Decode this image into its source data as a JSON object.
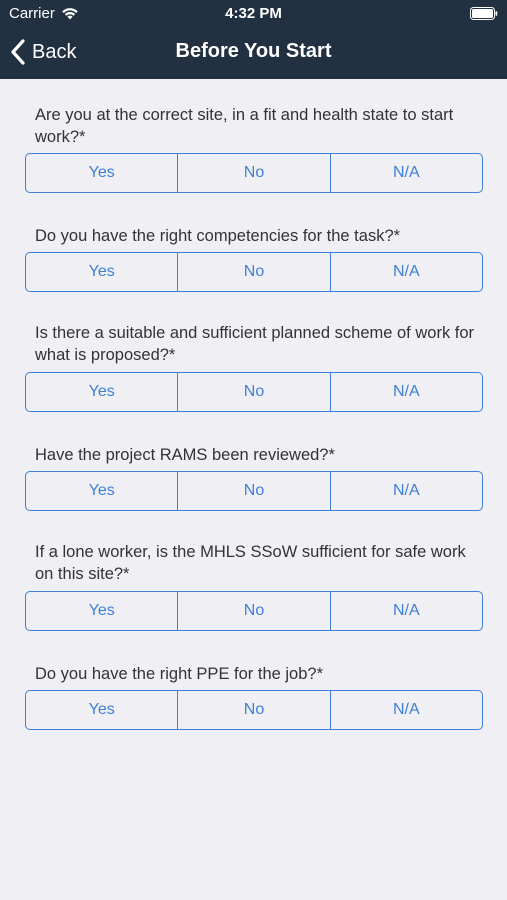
{
  "status_bar": {
    "carrier": "Carrier",
    "time": "4:32 PM",
    "wifi_icon": "wifi-icon",
    "battery_icon": "battery-icon"
  },
  "nav": {
    "back_label": "Back",
    "back_icon": "chevron-left-icon",
    "title": "Before You Start"
  },
  "colors": {
    "header_bg": "#223141",
    "accent": "#3f7fd8",
    "background": "#efeff4",
    "question_text": "#333333"
  },
  "questions": [
    {
      "text": "Are you at the correct site, in a fit and health state to start work?*",
      "options": [
        "Yes",
        "No",
        "N/A"
      ]
    },
    {
      "text": "Do you have the right competencies for the task?*",
      "options": [
        "Yes",
        "No",
        "N/A"
      ]
    },
    {
      "text": "Is there a suitable and sufficient planned scheme of work for what is proposed?*",
      "options": [
        "Yes",
        "No",
        "N/A"
      ]
    },
    {
      "text": "Have the project RAMS been reviewed?*",
      "options": [
        "Yes",
        "No",
        "N/A"
      ]
    },
    {
      "text": "If a lone worker, is the MHLS SSoW sufficient for safe work on this site?*",
      "options": [
        "Yes",
        "No",
        "N/A"
      ]
    },
    {
      "text": "Do you have the right PPE for the job?*",
      "options": [
        "Yes",
        "No",
        "N/A"
      ]
    }
  ]
}
